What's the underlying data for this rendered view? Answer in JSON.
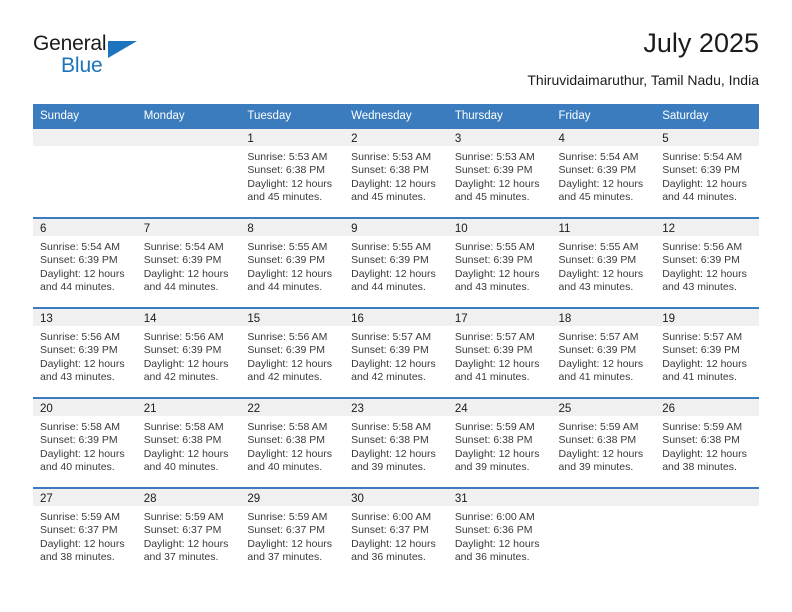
{
  "brand": {
    "name_top": "General",
    "name_bottom": "Blue",
    "triangle_color": "#1b74bd"
  },
  "header": {
    "title": "July 2025",
    "subtitle": "Thiruvidaimaruthur, Tamil Nadu, India"
  },
  "colors": {
    "header_blue": "#3a7cbe",
    "daynum_band": "#f0f0f0",
    "text": "#1b1b1b",
    "body_text": "#3a3a3a"
  },
  "calendar": {
    "weekday_headers": [
      "Sunday",
      "Monday",
      "Tuesday",
      "Wednesday",
      "Thursday",
      "Friday",
      "Saturday"
    ],
    "weeks": [
      [
        {
          "day": "",
          "sunrise": "",
          "sunset": "",
          "daylight": "",
          "empty": true
        },
        {
          "day": "",
          "sunrise": "",
          "sunset": "",
          "daylight": "",
          "empty": true
        },
        {
          "day": "1",
          "sunrise": "Sunrise: 5:53 AM",
          "sunset": "Sunset: 6:38 PM",
          "daylight": "Daylight: 12 hours and 45 minutes."
        },
        {
          "day": "2",
          "sunrise": "Sunrise: 5:53 AM",
          "sunset": "Sunset: 6:38 PM",
          "daylight": "Daylight: 12 hours and 45 minutes."
        },
        {
          "day": "3",
          "sunrise": "Sunrise: 5:53 AM",
          "sunset": "Sunset: 6:39 PM",
          "daylight": "Daylight: 12 hours and 45 minutes."
        },
        {
          "day": "4",
          "sunrise": "Sunrise: 5:54 AM",
          "sunset": "Sunset: 6:39 PM",
          "daylight": "Daylight: 12 hours and 45 minutes."
        },
        {
          "day": "5",
          "sunrise": "Sunrise: 5:54 AM",
          "sunset": "Sunset: 6:39 PM",
          "daylight": "Daylight: 12 hours and 44 minutes."
        }
      ],
      [
        {
          "day": "6",
          "sunrise": "Sunrise: 5:54 AM",
          "sunset": "Sunset: 6:39 PM",
          "daylight": "Daylight: 12 hours and 44 minutes."
        },
        {
          "day": "7",
          "sunrise": "Sunrise: 5:54 AM",
          "sunset": "Sunset: 6:39 PM",
          "daylight": "Daylight: 12 hours and 44 minutes."
        },
        {
          "day": "8",
          "sunrise": "Sunrise: 5:55 AM",
          "sunset": "Sunset: 6:39 PM",
          "daylight": "Daylight: 12 hours and 44 minutes."
        },
        {
          "day": "9",
          "sunrise": "Sunrise: 5:55 AM",
          "sunset": "Sunset: 6:39 PM",
          "daylight": "Daylight: 12 hours and 44 minutes."
        },
        {
          "day": "10",
          "sunrise": "Sunrise: 5:55 AM",
          "sunset": "Sunset: 6:39 PM",
          "daylight": "Daylight: 12 hours and 43 minutes."
        },
        {
          "day": "11",
          "sunrise": "Sunrise: 5:55 AM",
          "sunset": "Sunset: 6:39 PM",
          "daylight": "Daylight: 12 hours and 43 minutes."
        },
        {
          "day": "12",
          "sunrise": "Sunrise: 5:56 AM",
          "sunset": "Sunset: 6:39 PM",
          "daylight": "Daylight: 12 hours and 43 minutes."
        }
      ],
      [
        {
          "day": "13",
          "sunrise": "Sunrise: 5:56 AM",
          "sunset": "Sunset: 6:39 PM",
          "daylight": "Daylight: 12 hours and 43 minutes."
        },
        {
          "day": "14",
          "sunrise": "Sunrise: 5:56 AM",
          "sunset": "Sunset: 6:39 PM",
          "daylight": "Daylight: 12 hours and 42 minutes."
        },
        {
          "day": "15",
          "sunrise": "Sunrise: 5:56 AM",
          "sunset": "Sunset: 6:39 PM",
          "daylight": "Daylight: 12 hours and 42 minutes."
        },
        {
          "day": "16",
          "sunrise": "Sunrise: 5:57 AM",
          "sunset": "Sunset: 6:39 PM",
          "daylight": "Daylight: 12 hours and 42 minutes."
        },
        {
          "day": "17",
          "sunrise": "Sunrise: 5:57 AM",
          "sunset": "Sunset: 6:39 PM",
          "daylight": "Daylight: 12 hours and 41 minutes."
        },
        {
          "day": "18",
          "sunrise": "Sunrise: 5:57 AM",
          "sunset": "Sunset: 6:39 PM",
          "daylight": "Daylight: 12 hours and 41 minutes."
        },
        {
          "day": "19",
          "sunrise": "Sunrise: 5:57 AM",
          "sunset": "Sunset: 6:39 PM",
          "daylight": "Daylight: 12 hours and 41 minutes."
        }
      ],
      [
        {
          "day": "20",
          "sunrise": "Sunrise: 5:58 AM",
          "sunset": "Sunset: 6:39 PM",
          "daylight": "Daylight: 12 hours and 40 minutes."
        },
        {
          "day": "21",
          "sunrise": "Sunrise: 5:58 AM",
          "sunset": "Sunset: 6:38 PM",
          "daylight": "Daylight: 12 hours and 40 minutes."
        },
        {
          "day": "22",
          "sunrise": "Sunrise: 5:58 AM",
          "sunset": "Sunset: 6:38 PM",
          "daylight": "Daylight: 12 hours and 40 minutes."
        },
        {
          "day": "23",
          "sunrise": "Sunrise: 5:58 AM",
          "sunset": "Sunset: 6:38 PM",
          "daylight": "Daylight: 12 hours and 39 minutes."
        },
        {
          "day": "24",
          "sunrise": "Sunrise: 5:59 AM",
          "sunset": "Sunset: 6:38 PM",
          "daylight": "Daylight: 12 hours and 39 minutes."
        },
        {
          "day": "25",
          "sunrise": "Sunrise: 5:59 AM",
          "sunset": "Sunset: 6:38 PM",
          "daylight": "Daylight: 12 hours and 39 minutes."
        },
        {
          "day": "26",
          "sunrise": "Sunrise: 5:59 AM",
          "sunset": "Sunset: 6:38 PM",
          "daylight": "Daylight: 12 hours and 38 minutes."
        }
      ],
      [
        {
          "day": "27",
          "sunrise": "Sunrise: 5:59 AM",
          "sunset": "Sunset: 6:37 PM",
          "daylight": "Daylight: 12 hours and 38 minutes."
        },
        {
          "day": "28",
          "sunrise": "Sunrise: 5:59 AM",
          "sunset": "Sunset: 6:37 PM",
          "daylight": "Daylight: 12 hours and 37 minutes."
        },
        {
          "day": "29",
          "sunrise": "Sunrise: 5:59 AM",
          "sunset": "Sunset: 6:37 PM",
          "daylight": "Daylight: 12 hours and 37 minutes."
        },
        {
          "day": "30",
          "sunrise": "Sunrise: 6:00 AM",
          "sunset": "Sunset: 6:37 PM",
          "daylight": "Daylight: 12 hours and 36 minutes."
        },
        {
          "day": "31",
          "sunrise": "Sunrise: 6:00 AM",
          "sunset": "Sunset: 6:36 PM",
          "daylight": "Daylight: 12 hours and 36 minutes."
        },
        {
          "day": "",
          "sunrise": "",
          "sunset": "",
          "daylight": "",
          "empty": true
        },
        {
          "day": "",
          "sunrise": "",
          "sunset": "",
          "daylight": "",
          "empty": true
        }
      ]
    ]
  }
}
